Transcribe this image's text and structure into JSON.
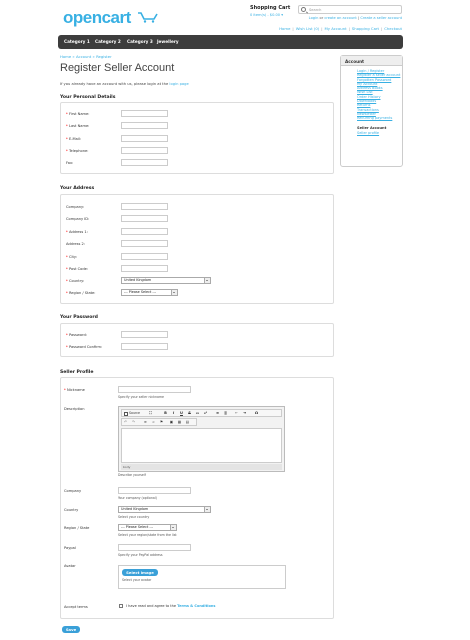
{
  "header": {
    "logo": "opencart",
    "cart_title": "Shopping Cart",
    "cart_summary": "0 item(s) - $0.00",
    "search_placeholder": "Search",
    "welcome": {
      "prefix": "",
      "login": "Login",
      "or": " or ",
      "create_account": "create an account",
      "pipe": " | ",
      "create_seller": "Create a seller account"
    },
    "links": [
      "Home",
      "Wish List (0)",
      "My Account",
      "Shopping Cart",
      "Checkout"
    ]
  },
  "menu": {
    "items": [
      "Category 1",
      "Category 2",
      "Category 3",
      "Jewellery"
    ]
  },
  "breadcrumb": [
    "Home",
    "Account",
    "Register"
  ],
  "page": {
    "title": "Register Seller Account",
    "intro_prefix": "If you already have an account with us, please login at the ",
    "intro_link": "login page"
  },
  "personal": {
    "heading": "Your Personal Details",
    "fields": [
      {
        "label": "First Name:",
        "required": true
      },
      {
        "label": "Last Name:",
        "required": true
      },
      {
        "label": "E-Mail:",
        "required": true
      },
      {
        "label": "Telephone:",
        "required": true
      },
      {
        "label": "Fax:",
        "required": false
      }
    ]
  },
  "address": {
    "heading": "Your Address",
    "fields": [
      {
        "label": "Company:",
        "required": false
      },
      {
        "label": "Company ID:",
        "required": false
      },
      {
        "label": "Address 1:",
        "required": true
      },
      {
        "label": "Address 2:",
        "required": false
      },
      {
        "label": "City:",
        "required": true
      },
      {
        "label": "Post Code:",
        "required": true
      },
      {
        "label": "Country:",
        "required": true
      },
      {
        "label": "Region / State:",
        "required": true
      }
    ],
    "country_value": "United Kingdom",
    "region_value": " --- Please Select --- "
  },
  "password": {
    "heading": "Your Password",
    "fields": [
      {
        "label": "Password:",
        "required": true
      },
      {
        "label": "Password Confirm:",
        "required": true
      }
    ]
  },
  "seller": {
    "heading": "Seller Profile",
    "nickname": {
      "label": "Nickname",
      "hint": "Specify your seller nickname"
    },
    "description": {
      "label": "Description",
      "hint": "Describe yourself",
      "source_label": "Source",
      "footer": "body"
    },
    "company": {
      "label": "Company",
      "hint": "Your company (optional)"
    },
    "country": {
      "label": "Country",
      "value": "United Kingdom",
      "hint": "Select your country"
    },
    "region": {
      "label": "Region / State",
      "value": " --- Please Select --- ",
      "hint": "Select your region/state from the list"
    },
    "paypal": {
      "label": "Paypal",
      "hint": "Specify your PayPal address"
    },
    "avatar": {
      "label": "Avatar",
      "button": "Select image",
      "hint": "Select your avatar"
    },
    "terms": {
      "label": "Accept terms",
      "text": "I have read and agree to the ",
      "link": "Terms & Conditions"
    },
    "save": "Save"
  },
  "sidebar": {
    "title": "Account",
    "links": [
      "Login",
      "Register",
      "Register a seller account",
      "Forgotten Password",
      "My Account",
      "Address Books",
      "Wish List",
      "Order History",
      "Downloads",
      "Returns",
      "Transactions",
      "Newsletter",
      "Recurring payments"
    ],
    "seller_heading": "Seller Account",
    "seller_links": [
      "Seller profile"
    ]
  }
}
